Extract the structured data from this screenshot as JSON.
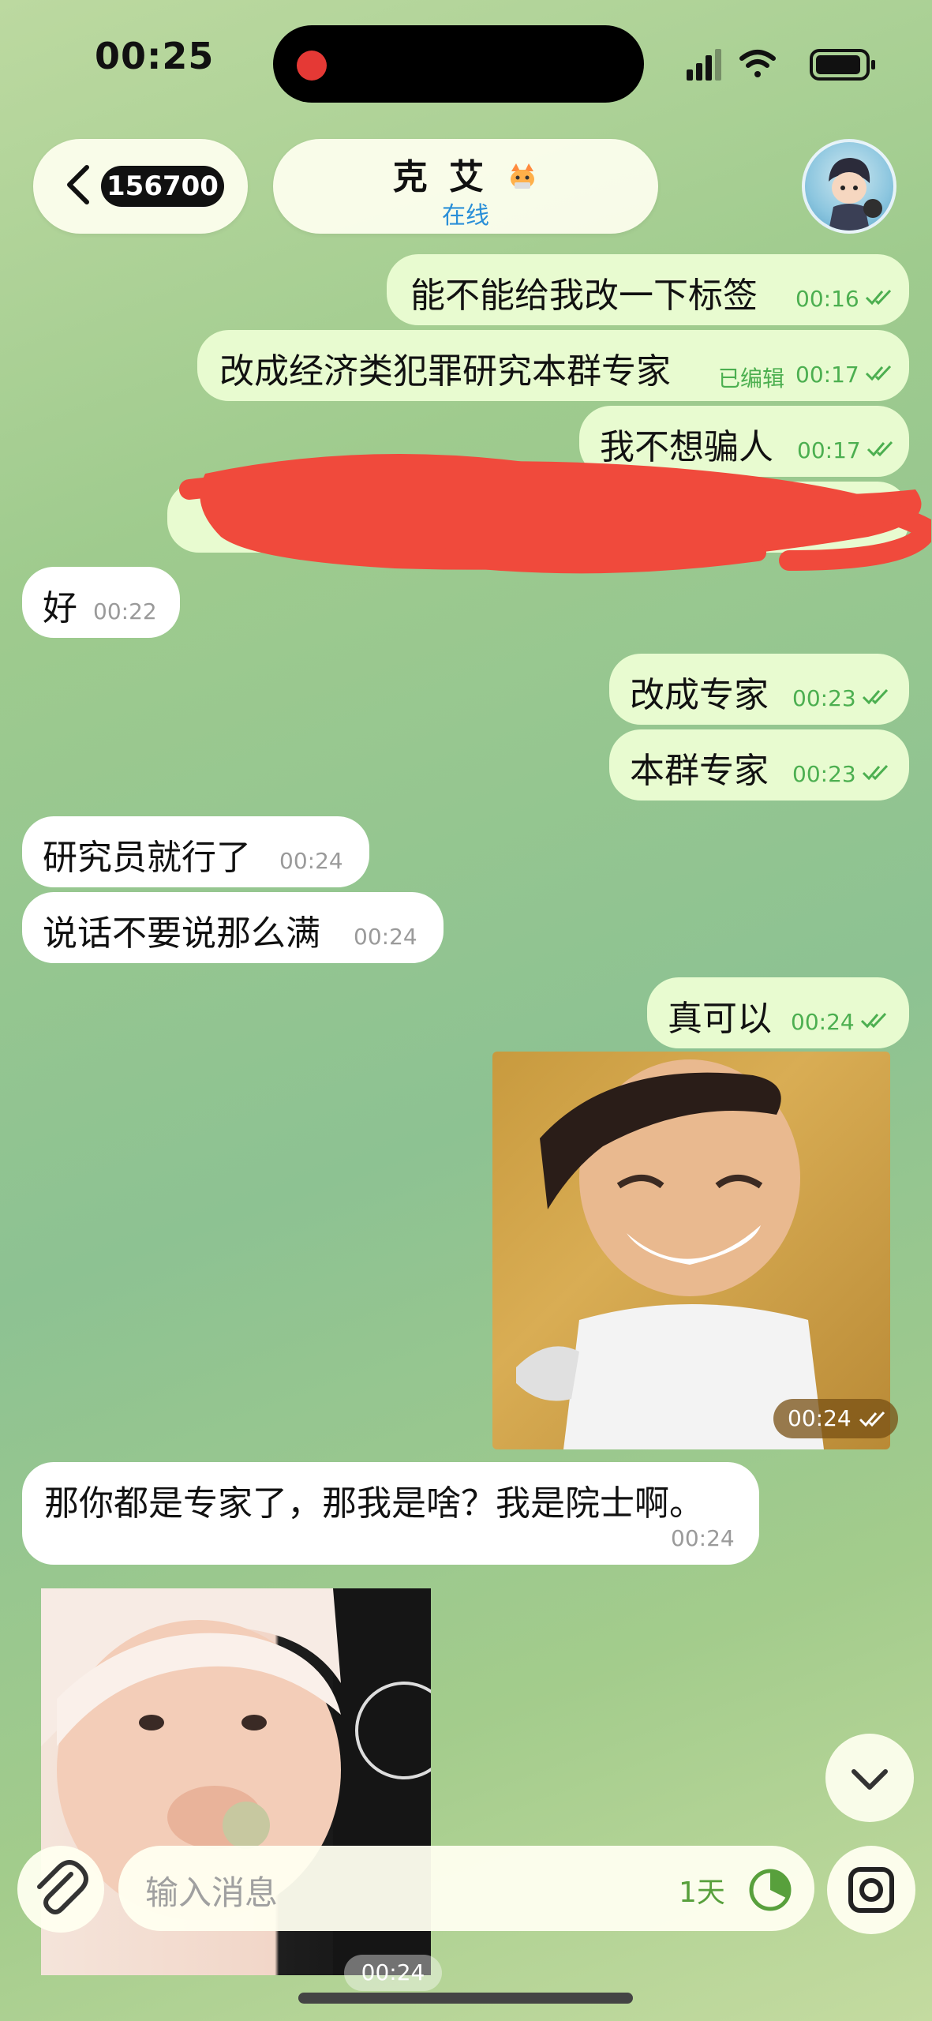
{
  "status_bar": {
    "time": "00:25"
  },
  "header": {
    "back_count": "156700",
    "title": "克 艾",
    "status": "在线"
  },
  "messages": [
    {
      "dir": "out",
      "text": "能不能给我改一下标签",
      "time": "00:16"
    },
    {
      "dir": "out",
      "text": "改成经济类犯罪研究本群专家",
      "edited": "已编辑",
      "time": "00:17"
    },
    {
      "dir": "out",
      "text": "我不想骗人",
      "time": "00:17"
    },
    {
      "dir": "in",
      "text": "好",
      "time": "00:22"
    },
    {
      "dir": "out",
      "text": "改成专家",
      "time": "00:23"
    },
    {
      "dir": "out",
      "text": "本群专家",
      "time": "00:23"
    },
    {
      "dir": "in",
      "text": "研究员就行了",
      "time": "00:24"
    },
    {
      "dir": "in",
      "text": "说话不要说那么满",
      "time": "00:24"
    },
    {
      "dir": "out",
      "text": "真可以",
      "time": "00:24"
    },
    {
      "dir": "out",
      "type": "sticker",
      "time": "00:24"
    },
    {
      "dir": "in",
      "text": "那你都是专家了，那我是啥？我是院士啊。",
      "time": "00:24"
    },
    {
      "dir": "in",
      "type": "sticker",
      "time": "00:24"
    }
  ],
  "composer": {
    "placeholder": "输入消息",
    "timer_label": "1天"
  },
  "colors": {
    "outgoing_bubble": "#e8fbd0",
    "incoming_bubble": "#ffffff",
    "check_green": "#4caf50",
    "redaction": "#f04a3c"
  }
}
